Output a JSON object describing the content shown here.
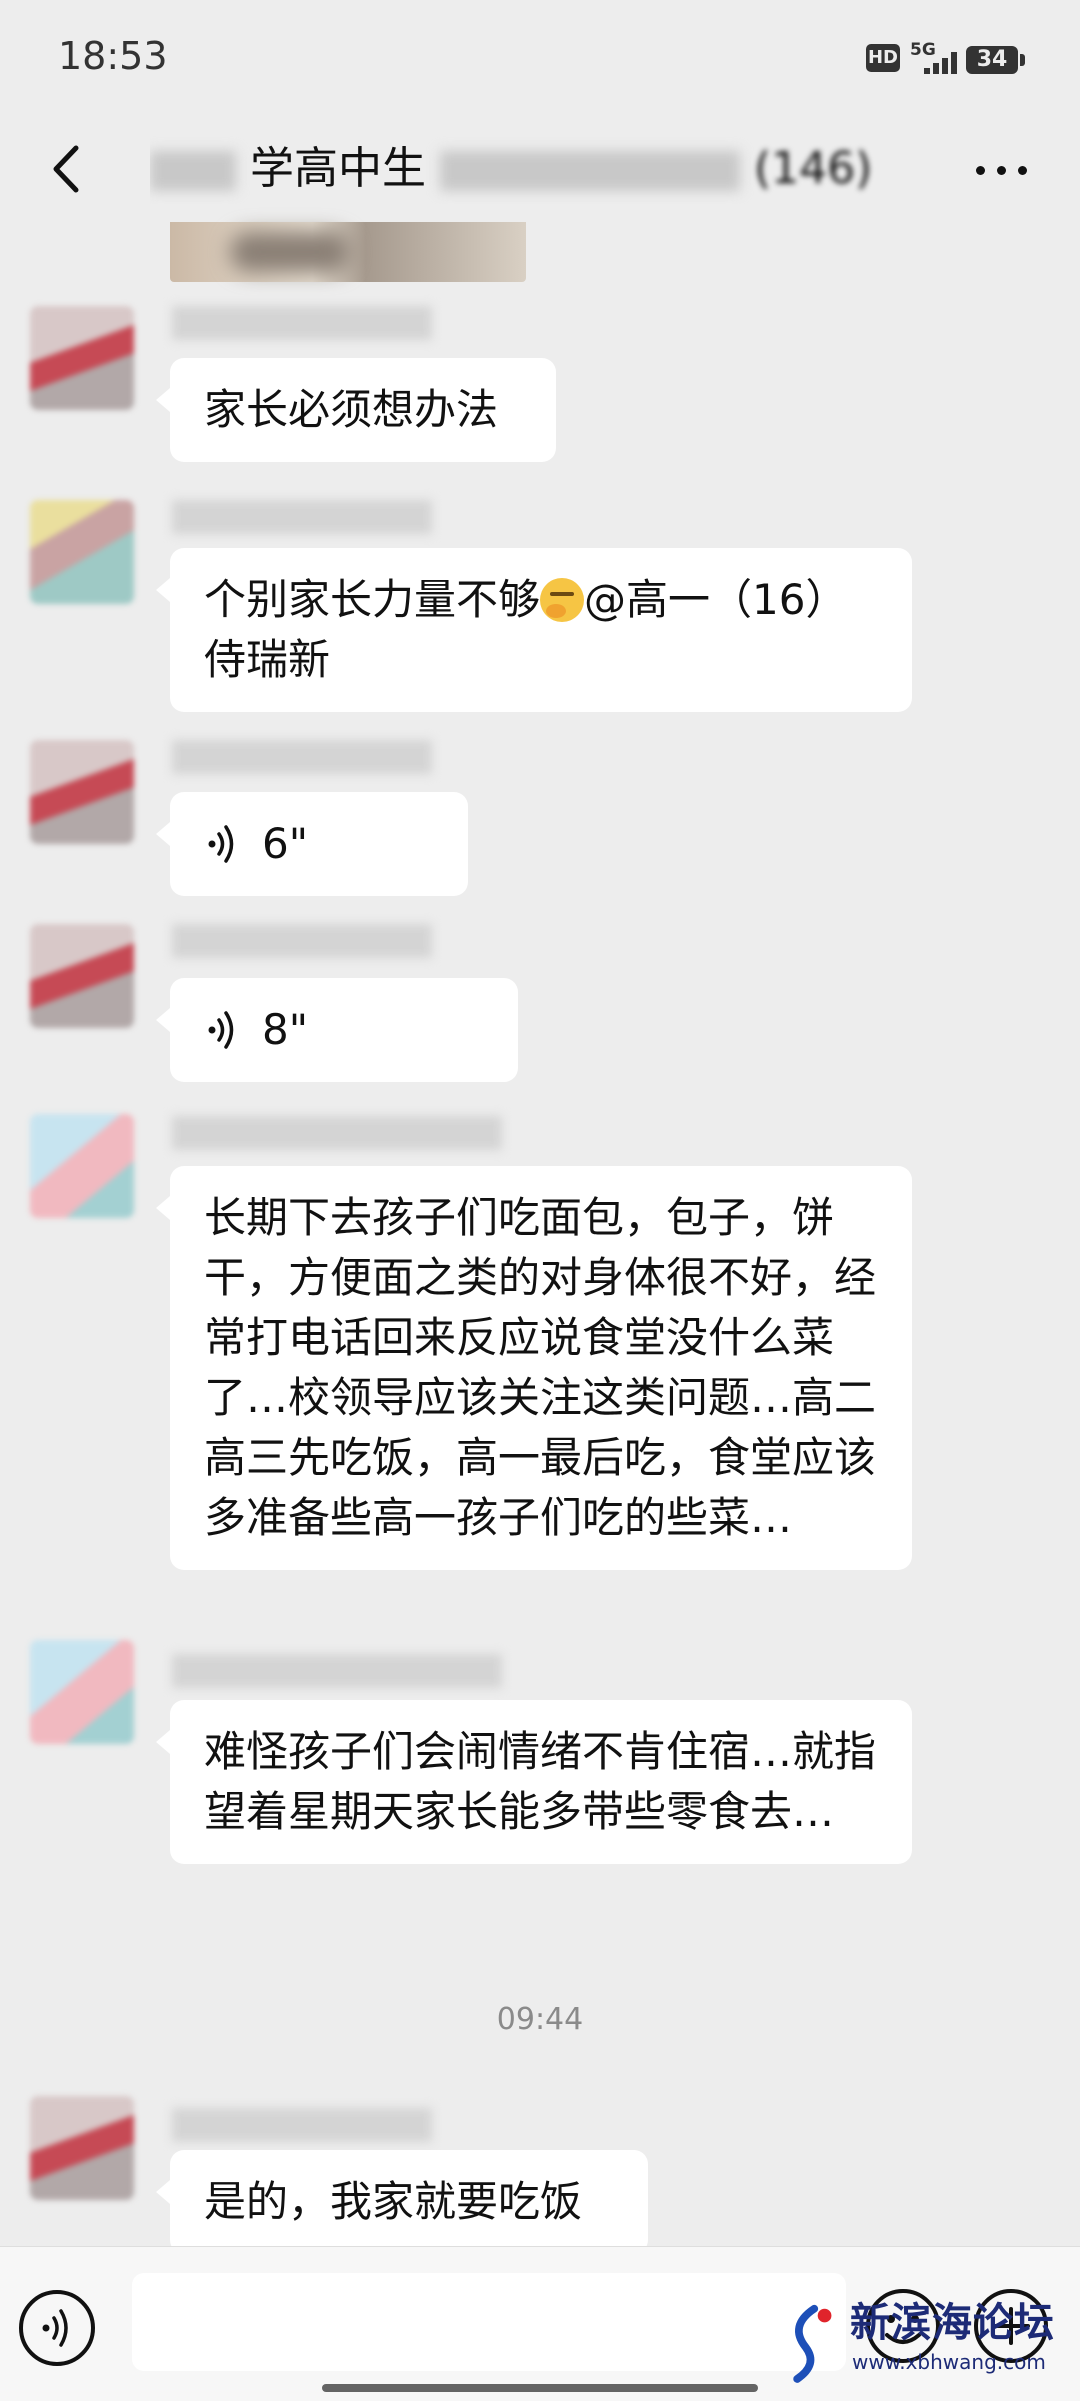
{
  "status_bar": {
    "time": "18:53",
    "hd": "HD",
    "network": "5G",
    "battery": "34"
  },
  "nav": {
    "title_visible": "学高中生",
    "title_count": "(146)"
  },
  "messages": [
    {
      "type": "text",
      "text": "家长必须想办法"
    },
    {
      "type": "text",
      "text_before_emoji": "个别家长力量不够",
      "text_after_emoji": "@高一（16）侍瑞新"
    },
    {
      "type": "voice",
      "duration": "6\""
    },
    {
      "type": "voice",
      "duration": "8\""
    },
    {
      "type": "text",
      "text": "长期下去孩子们吃面包，包子，饼干，方便面之类的对身体很不好，经常打电话回来反应说食堂没什么菜了…校领导应该关注这类问题…高二高三先吃饭，高一最后吃，食堂应该多准备些高一孩子们吃的些菜…"
    },
    {
      "type": "text",
      "text": "难怪孩子们会闹情绪不肯住宿…就指望着星期天家长能多带些零食去…"
    },
    {
      "type": "time",
      "text": "09:44"
    },
    {
      "type": "text",
      "text": "是的，我家就要吃饭"
    }
  ],
  "watermark": {
    "title": "新滨海论坛",
    "url": "www.xbhwang.com"
  },
  "icons": [
    "back-icon",
    "more-icon",
    "voice-wave-icon",
    "voice-input-icon",
    "emoji-icon",
    "plus-icon"
  ]
}
